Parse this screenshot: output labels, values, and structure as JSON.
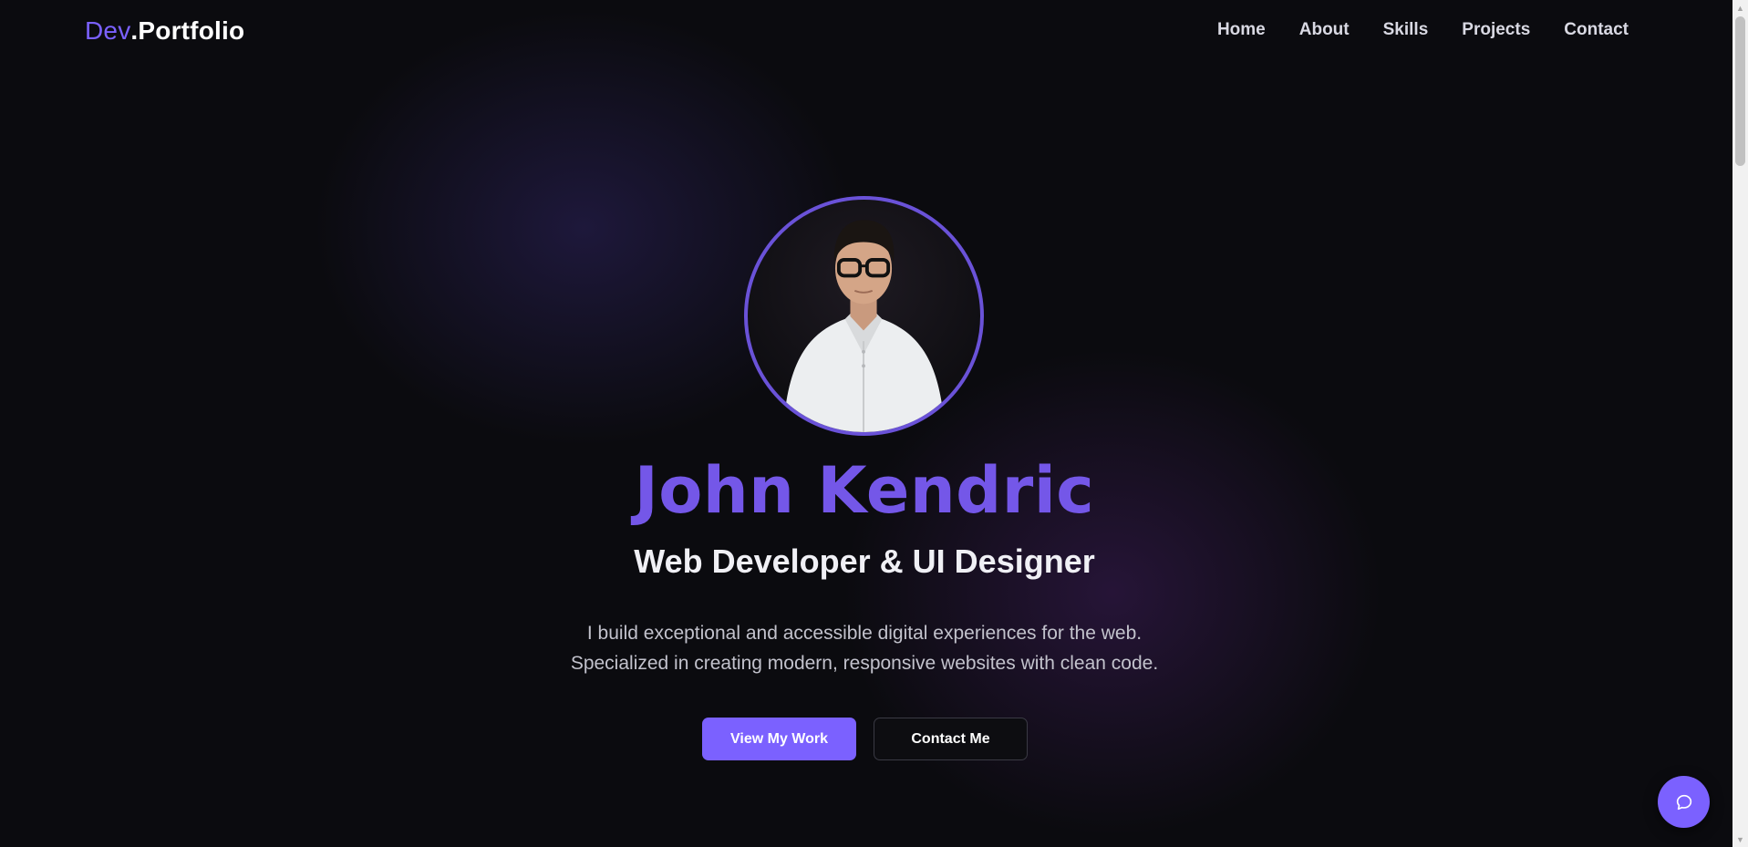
{
  "nav": {
    "logo_accent": "Dev",
    "logo_rest": ".Portfolio",
    "links": [
      "Home",
      "About",
      "Skills",
      "Projects",
      "Contact"
    ]
  },
  "hero": {
    "name": "John Kendric",
    "role": "Web Developer & UI Designer",
    "description_line1": "I build exceptional and accessible digital experiences for the web.",
    "description_line2": "Specialized in creating modern, responsive websites with clean code.",
    "primary_button": "View My Work",
    "secondary_button": "Contact Me"
  },
  "icons": {
    "chat": "chat-bubble-icon",
    "scroll_up": "arrow-up-icon",
    "scroll_down": "arrow-down-icon"
  },
  "colors": {
    "accent": "#7b61ff",
    "name": "#7457e8",
    "background": "#0b0b0f"
  }
}
